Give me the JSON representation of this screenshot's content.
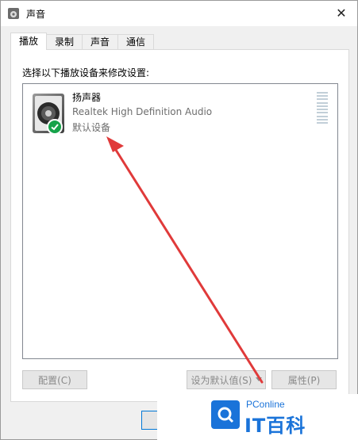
{
  "window": {
    "title": "声音",
    "close_glyph": "✕"
  },
  "tabs": [
    {
      "label": "播放",
      "active": true
    },
    {
      "label": "录制",
      "active": false
    },
    {
      "label": "声音",
      "active": false
    },
    {
      "label": "通信",
      "active": false
    }
  ],
  "playback": {
    "instruction": "选择以下播放设备来修改设置:",
    "devices": [
      {
        "name": "扬声器",
        "driver": "Realtek High Definition Audio",
        "status": "默认设备",
        "icon": "speaker-icon",
        "badge_icon": "check-icon",
        "level_fraction": 0
      }
    ]
  },
  "buttons": {
    "configure": "配置(C)",
    "set_default": "设为默认值(S)",
    "properties": "属性(P)"
  },
  "watermark": {
    "pconline": "PConline",
    "brand": "IT百科"
  },
  "colors": {
    "accent_blue": "#0078d7",
    "check_green": "#16a34a",
    "annotation_red": "#e03a3a",
    "watermark_blue": "#1a73d9"
  }
}
